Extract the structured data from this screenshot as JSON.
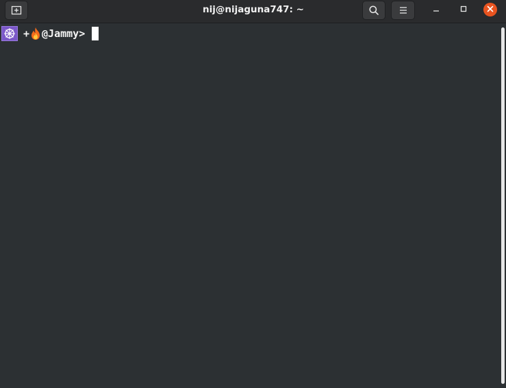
{
  "window": {
    "title": "nij@nijaguna747: ~"
  },
  "headerbar": {
    "icons": {
      "new_tab": "new-tab-icon",
      "search": "search-icon",
      "menu": "hamburger-menu-icon",
      "minimize": "minimize-icon",
      "maximize": "maximize-icon",
      "close": "close-icon"
    }
  },
  "terminal": {
    "prompt": {
      "badge_icon": "kubernetes-helm-icon",
      "plus": "+",
      "fire_icon": "fire-emoji-icon",
      "text": "@Jammy>"
    }
  },
  "colors": {
    "background": "#2c3033",
    "headerbar": "#2a2b2d",
    "close_button": "#e95420",
    "badge": "#7b58c8",
    "text": "#f4f4f4"
  }
}
